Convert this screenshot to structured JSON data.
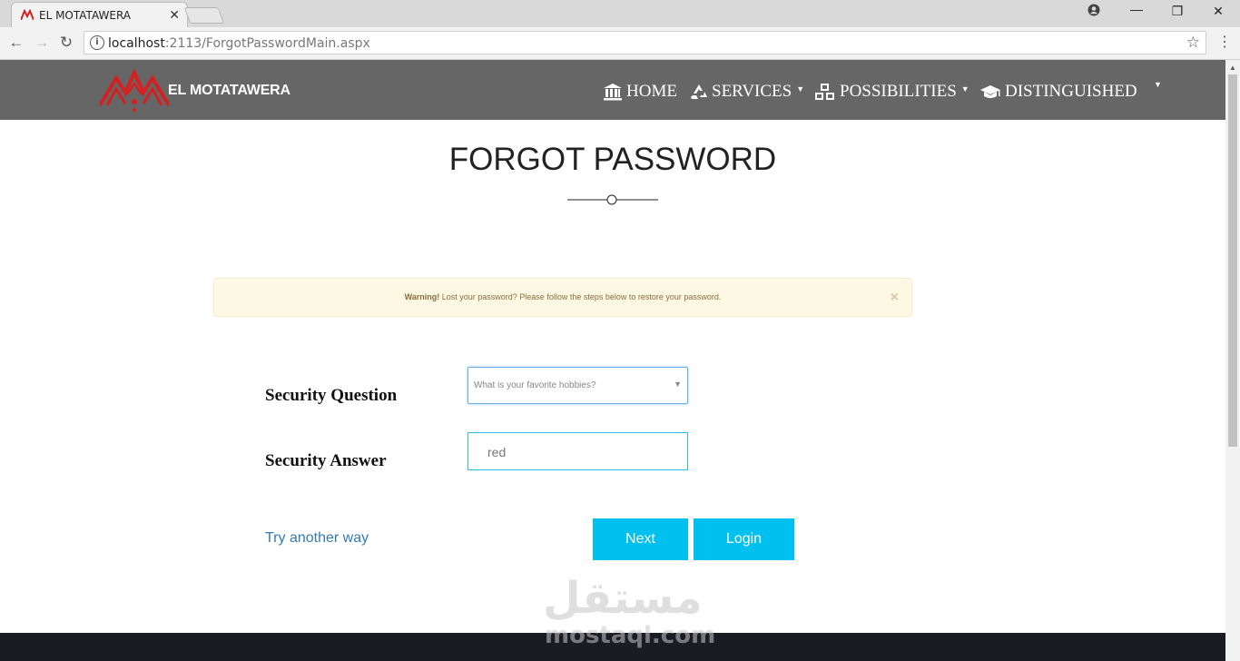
{
  "browser": {
    "tab_title": "EL MOTATAWERA",
    "url_host": "localhost",
    "url_path": ":2113/ForgotPasswordMain.aspx",
    "icons": [
      "info-icon",
      "star-icon",
      "back-icon",
      "forward-icon",
      "reload-icon",
      "account-icon",
      "minimize-icon",
      "maximize-icon",
      "close-icon",
      "menu-icon"
    ]
  },
  "navbar": {
    "brand": "EL MOTATAWERA",
    "items": [
      {
        "label": "HOME",
        "icon": "bank-icon",
        "dropdown": false
      },
      {
        "label": "SERVICES",
        "icon": "recycle-icon",
        "dropdown": true
      },
      {
        "label": "POSSIBILITIES",
        "icon": "cubes-icon",
        "dropdown": true
      },
      {
        "label": "DISTINGUISHED",
        "icon": "graduation-cap-icon",
        "dropdown": true
      }
    ],
    "background": "#666666",
    "logo_color": "#d42020"
  },
  "main": {
    "title": "FORGOT PASSWORD",
    "alert": {
      "strong": "Warning!",
      "message": " Lost your password? Please follow the steps below to restore your password.",
      "close": "×"
    },
    "form": {
      "question_label": "Security Question",
      "question_value": "What is your favorite hobbies?",
      "answer_label": "Security Answer",
      "answer_value": "red"
    },
    "try_another": "Try another way",
    "next_button": "Next",
    "login_button": "Login",
    "accent": "#00c0ef"
  },
  "watermark": {
    "arabic": "مستقل",
    "latin": "mostaql.com"
  }
}
